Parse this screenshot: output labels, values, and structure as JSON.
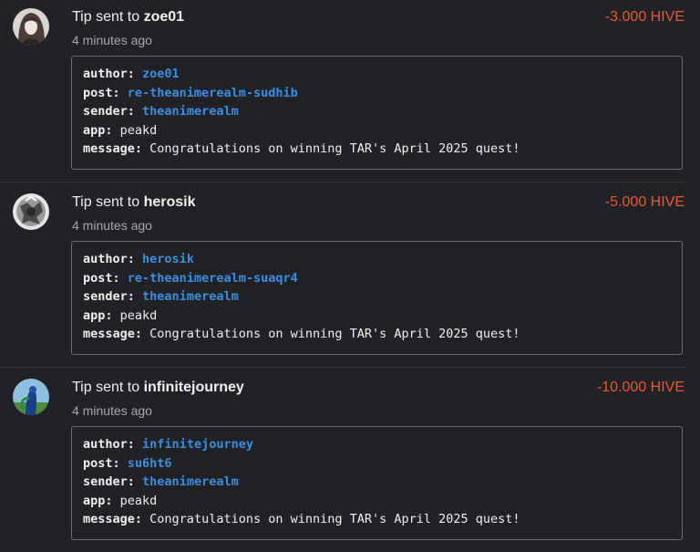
{
  "colors": {
    "background": "#212226",
    "amount": "#ec5a33",
    "link": "#3c8fe0",
    "muted": "#a6a8ad",
    "border": "#6a6d73"
  },
  "entries": [
    {
      "title_prefix": "Tip sent to",
      "user": "zoe01",
      "time": "4 minutes ago",
      "amount": "-3.000 HIVE",
      "memo": {
        "author_key": "author:",
        "author": "zoe01",
        "post_key": "post:",
        "post": "re-theanimerealm-sudhib",
        "sender_key": "sender:",
        "sender": "theanimerealm",
        "app_key": "app:",
        "app": "peakd",
        "message_key": "message:",
        "message": "Congratulations on winning TAR's April 2025 quest!"
      }
    },
    {
      "title_prefix": "Tip sent to",
      "user": "herosik",
      "time": "4 minutes ago",
      "amount": "-5.000 HIVE",
      "memo": {
        "author_key": "author:",
        "author": "herosik",
        "post_key": "post:",
        "post": "re-theanimerealm-suaqr4",
        "sender_key": "sender:",
        "sender": "theanimerealm",
        "app_key": "app:",
        "app": "peakd",
        "message_key": "message:",
        "message": "Congratulations on winning TAR's April 2025 quest!"
      }
    },
    {
      "title_prefix": "Tip sent to",
      "user": "infinitejourney",
      "time": "4 minutes ago",
      "amount": "-10.000 HIVE",
      "memo": {
        "author_key": "author:",
        "author": "infinitejourney",
        "post_key": "post:",
        "post": "su6ht6",
        "sender_key": "sender:",
        "sender": "theanimerealm",
        "app_key": "app:",
        "app": "peakd",
        "message_key": "message:",
        "message": "Congratulations on winning TAR's April 2025 quest!"
      }
    }
  ]
}
